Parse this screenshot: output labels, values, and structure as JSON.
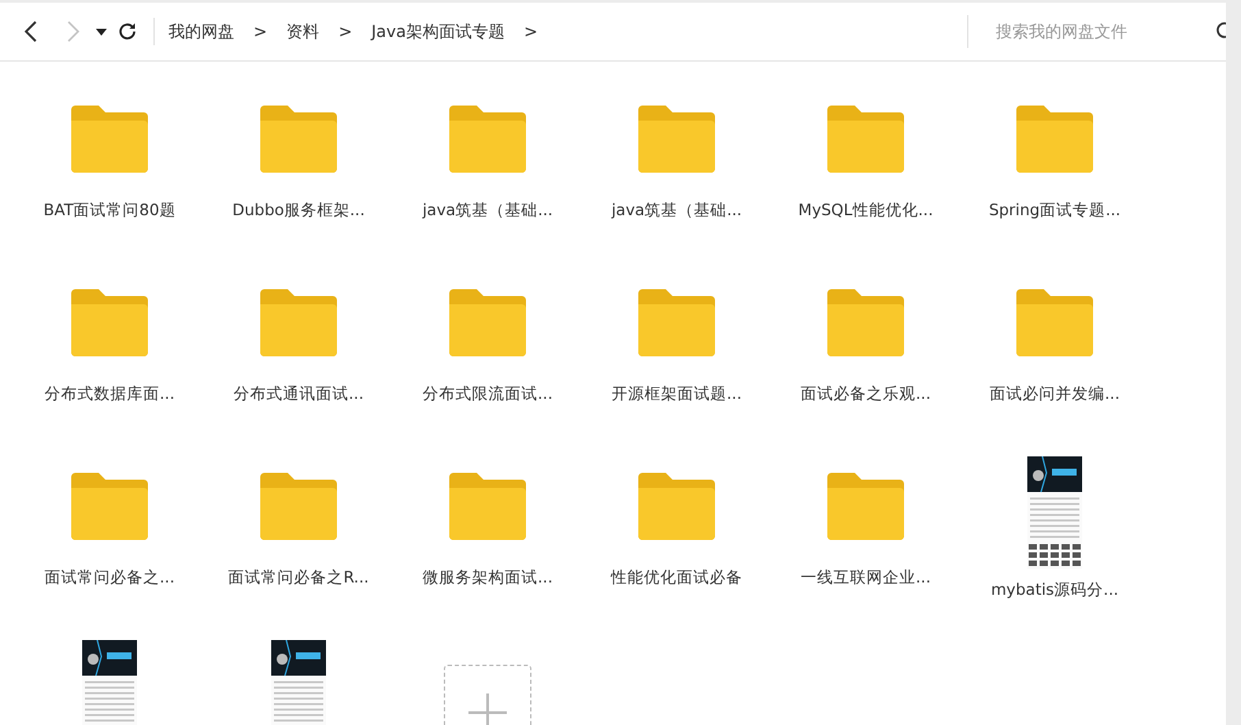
{
  "toolbar": {
    "back": {
      "disabled": false
    },
    "forward": {
      "disabled": true
    }
  },
  "breadcrumb": [
    {
      "label": "我的网盘",
      "separator": ">"
    },
    {
      "label": "资料",
      "separator": ">"
    },
    {
      "label": "Java架构面试专题",
      "separator": ">"
    }
  ],
  "search": {
    "placeholder": "搜索我的网盘文件"
  },
  "items": [
    {
      "kind": "folder",
      "name": "BAT面试常问80题"
    },
    {
      "kind": "folder",
      "name": "Dubbo服务框架..."
    },
    {
      "kind": "folder",
      "name": "java筑基（基础..."
    },
    {
      "kind": "folder",
      "name": "java筑基（基础..."
    },
    {
      "kind": "folder",
      "name": "MySQL性能优化..."
    },
    {
      "kind": "folder",
      "name": "Spring面试专题..."
    },
    {
      "kind": "folder",
      "name": "分布式数据库面..."
    },
    {
      "kind": "folder",
      "name": "分布式通讯面试..."
    },
    {
      "kind": "folder",
      "name": "分布式限流面试..."
    },
    {
      "kind": "folder",
      "name": "开源框架面试题..."
    },
    {
      "kind": "folder",
      "name": "面试必备之乐观..."
    },
    {
      "kind": "folder",
      "name": "面试必问并发编..."
    },
    {
      "kind": "folder",
      "name": "面试常问必备之..."
    },
    {
      "kind": "folder",
      "name": "面试常问必备之R..."
    },
    {
      "kind": "folder",
      "name": "微服务架构面试..."
    },
    {
      "kind": "folder",
      "name": "性能优化面试必备"
    },
    {
      "kind": "folder",
      "name": "一线互联网企业..."
    },
    {
      "kind": "image",
      "name": "mybatis源码分..."
    },
    {
      "kind": "image"
    },
    {
      "kind": "image"
    },
    {
      "kind": "add"
    }
  ]
}
